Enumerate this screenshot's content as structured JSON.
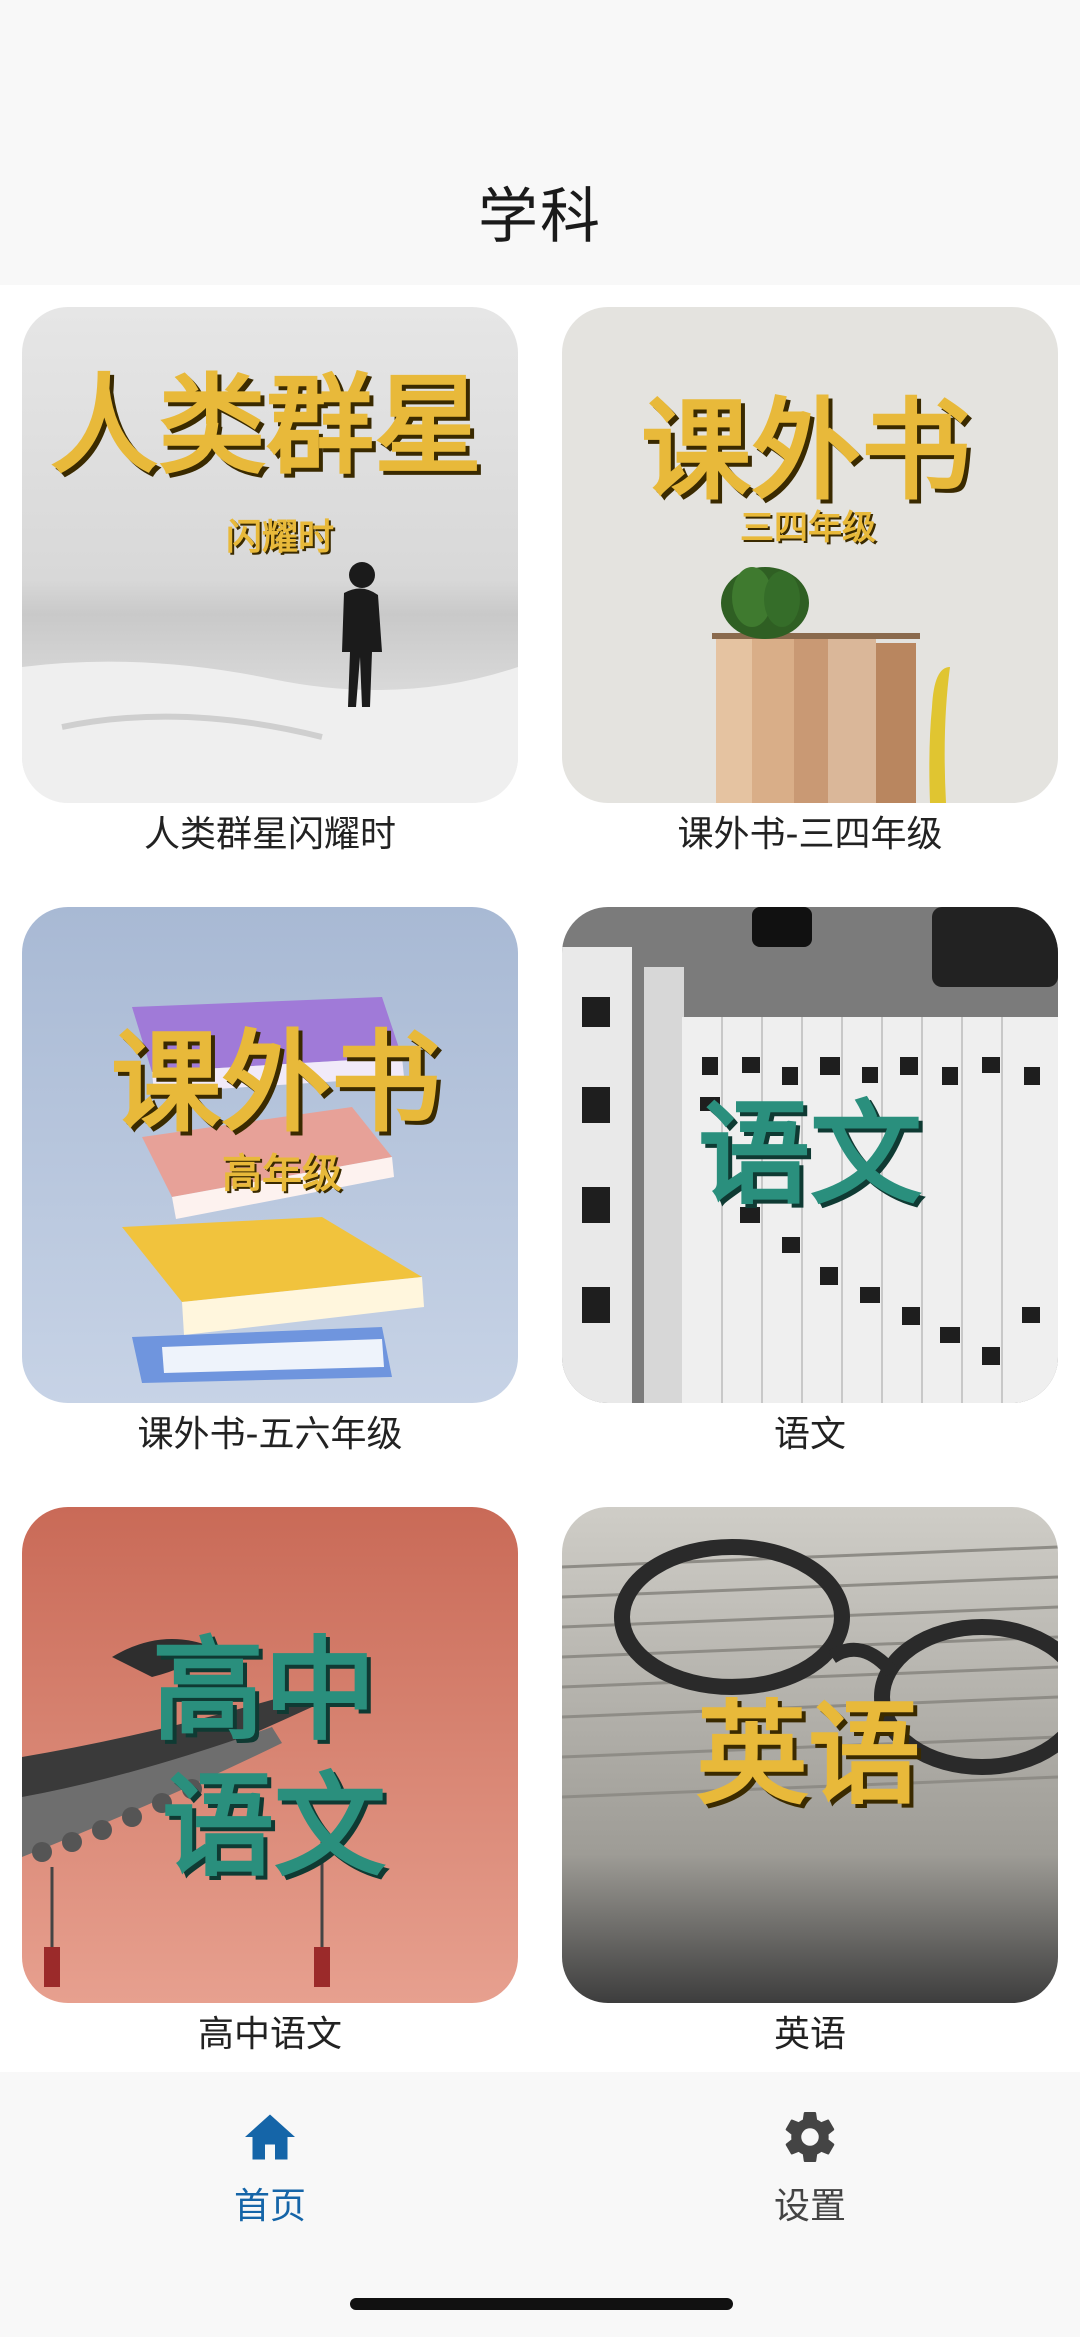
{
  "header": {
    "title": "学科"
  },
  "cards": [
    {
      "label": "人类群星闪耀时",
      "cover_title": "人类群星",
      "cover_sub": "闪耀时"
    },
    {
      "label": "课外书-三四年级",
      "cover_title": "课外书",
      "cover_sub": "三四年级"
    },
    {
      "label": "课外书-五六年级",
      "cover_title": "课外书",
      "cover_sub": "高年级"
    },
    {
      "label": "语文",
      "cover_title": "语文",
      "cover_sub": ""
    },
    {
      "label": "高中语文",
      "cover_title": "高中",
      "cover_sub": "语文"
    },
    {
      "label": "英语",
      "cover_title": "英语",
      "cover_sub": ""
    }
  ],
  "tabbar": {
    "tabs": [
      {
        "label": "首页",
        "icon": "home-icon",
        "active": true
      },
      {
        "label": "设置",
        "icon": "gear-icon",
        "active": false
      }
    ]
  },
  "colors": {
    "accent": "#1565a8",
    "gold": "#e8b93a",
    "teal": "#2a8f7d",
    "inactive": "#444444"
  }
}
